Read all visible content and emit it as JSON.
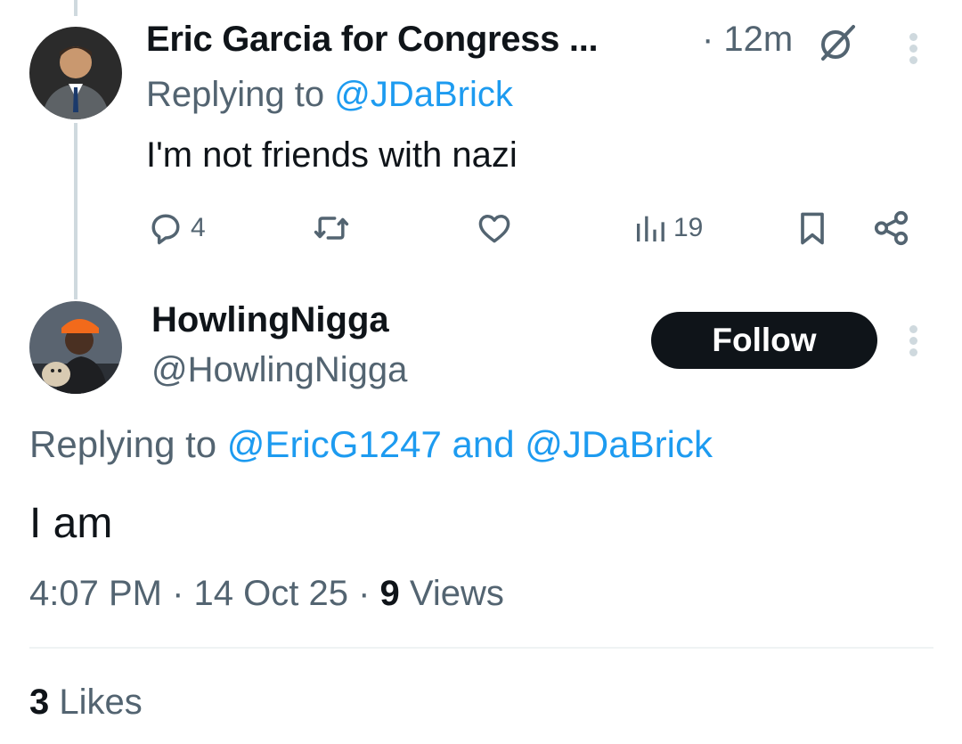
{
  "tweet1": {
    "display_name": "Eric Garcia for Congress ...",
    "time": "· 12m",
    "replying_prefix": "Replying to ",
    "replying_to": "@JDaBrick",
    "text": "I'm not friends with nazi",
    "actions": {
      "reply_count": "4",
      "repost_count": "",
      "like_count": "",
      "views_count": "19"
    }
  },
  "tweet2": {
    "display_name": "HowlingNigga",
    "handle": "@HowlingNigga",
    "follow_label": "Follow",
    "replying_prefix": "Replying to ",
    "replying_to_1": "@EricG1247",
    "replying_and": " and ",
    "replying_to_2": "@JDaBrick",
    "text": "I am",
    "timestamp": "4:07 PM · 14 Oct 25 · ",
    "views_count": "9",
    "views_label": " Views",
    "likes_count": "3",
    "likes_label": " Likes"
  },
  "icons": {
    "reply": "reply-icon",
    "repost": "repost-icon",
    "like": "heart-icon",
    "views": "views-icon",
    "bookmark": "bookmark-icon",
    "share": "share-icon",
    "grok": "grok-icon",
    "more": "more-icon"
  },
  "colors": {
    "text": "#0f1419",
    "secondary": "#536471",
    "accent": "#1d9bf0",
    "button_bg": "#0f1419"
  }
}
